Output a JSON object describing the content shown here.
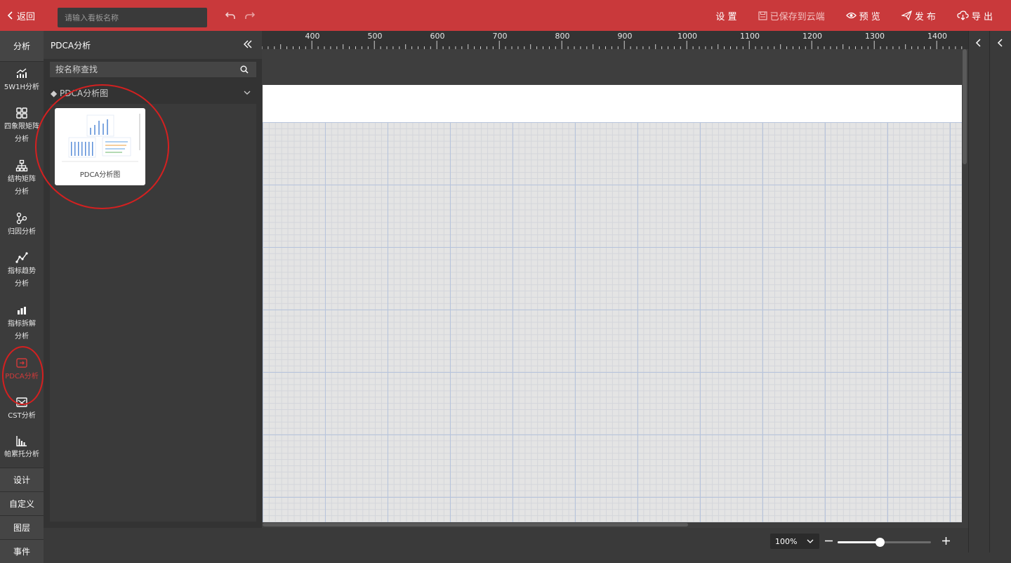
{
  "topbar": {
    "back_label": "返回",
    "name_placeholder": "请输入看板名称",
    "settings_label": "设 置",
    "saved_label": "已保存到云端",
    "preview_label": "预 览",
    "publish_label": "发 布",
    "export_label": "导 出",
    "bg_color": "#c9393b"
  },
  "nav": {
    "analysis_label": "分析",
    "items": [
      {
        "label_1": "5W1H分析",
        "label_2": "",
        "icon": "chart-growth-icon"
      },
      {
        "label_1": "四象限矩阵",
        "label_2": "分析",
        "icon": "grid-quad-icon"
      },
      {
        "label_1": "结构矩阵",
        "label_2": "分析",
        "icon": "hierarchy-icon"
      },
      {
        "label_1": "归因分析",
        "label_2": "",
        "icon": "attribution-icon"
      },
      {
        "label_1": "指标趋势",
        "label_2": "分析",
        "icon": "trend-line-icon"
      },
      {
        "label_1": "指标拆解",
        "label_2": "分析",
        "icon": "bars-icon"
      },
      {
        "label_1": "PDCA分析",
        "label_2": "",
        "icon": "pdca-icon"
      },
      {
        "label_1": "CST分析",
        "label_2": "",
        "icon": "cst-icon"
      },
      {
        "label_1": "帕累托分析",
        "label_2": "",
        "icon": "pareto-icon"
      }
    ],
    "design_label": "设计",
    "custom_label": "自定义",
    "layers_label": "图层",
    "events_label": "事件",
    "active_color": "#d23a3a"
  },
  "panel": {
    "title": "PDCA分析",
    "search_placeholder": "按名称查找",
    "group_title": "◆ PDCA分析图",
    "card_label": "PDCA分析图"
  },
  "ruler": {
    "labels": [
      "400",
      "500",
      "600",
      "700",
      "800",
      "900",
      "1000",
      "1100",
      "1200",
      "1300",
      "1400"
    ]
  },
  "zoom": {
    "value_label": "100%",
    "level": 0.45
  }
}
